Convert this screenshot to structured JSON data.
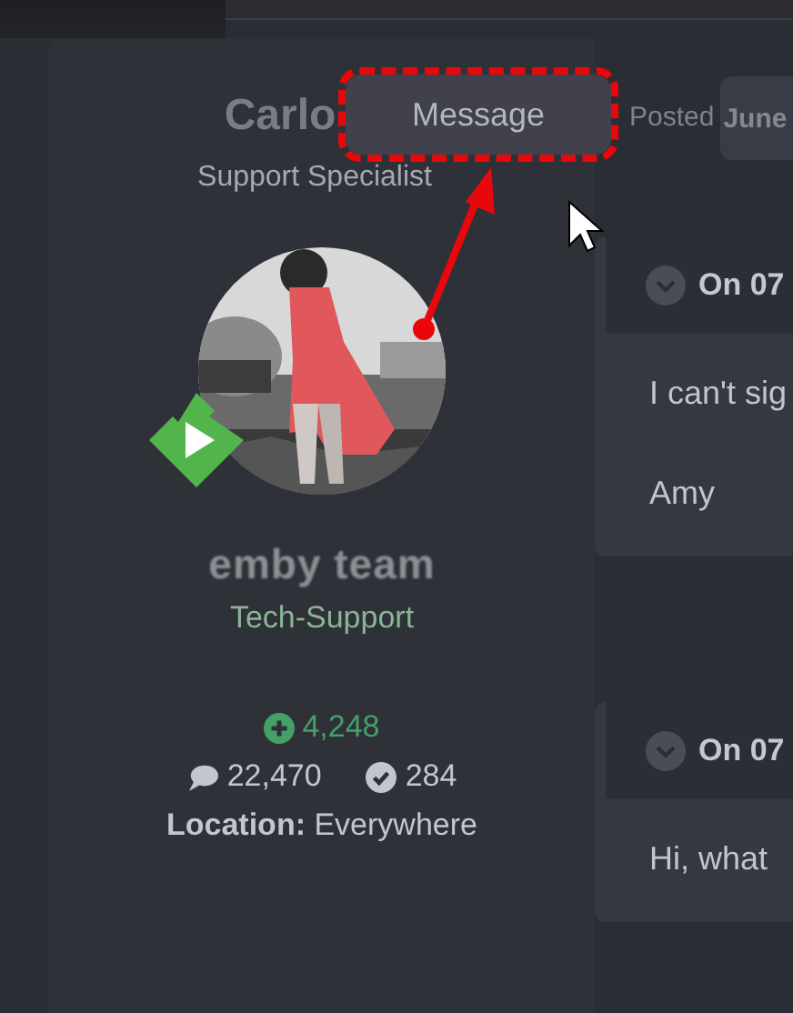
{
  "header": {
    "author": "Carlo",
    "role": "Support Specialist",
    "posted": "Posted",
    "date": "June"
  },
  "tooltip": {
    "label": "Message"
  },
  "profile": {
    "logo": "emby team",
    "group": "Tech-Support",
    "reputation": "4,248",
    "post_count": "22,470",
    "solutions": "284",
    "location_label": "Location:",
    "location": "Everywhere"
  },
  "posts": [
    {
      "date": "On 07",
      "lines": [
        "I can't sig",
        "Amy"
      ]
    },
    {
      "date": "On 07",
      "lines": [
        "Hi, what"
      ]
    }
  ]
}
